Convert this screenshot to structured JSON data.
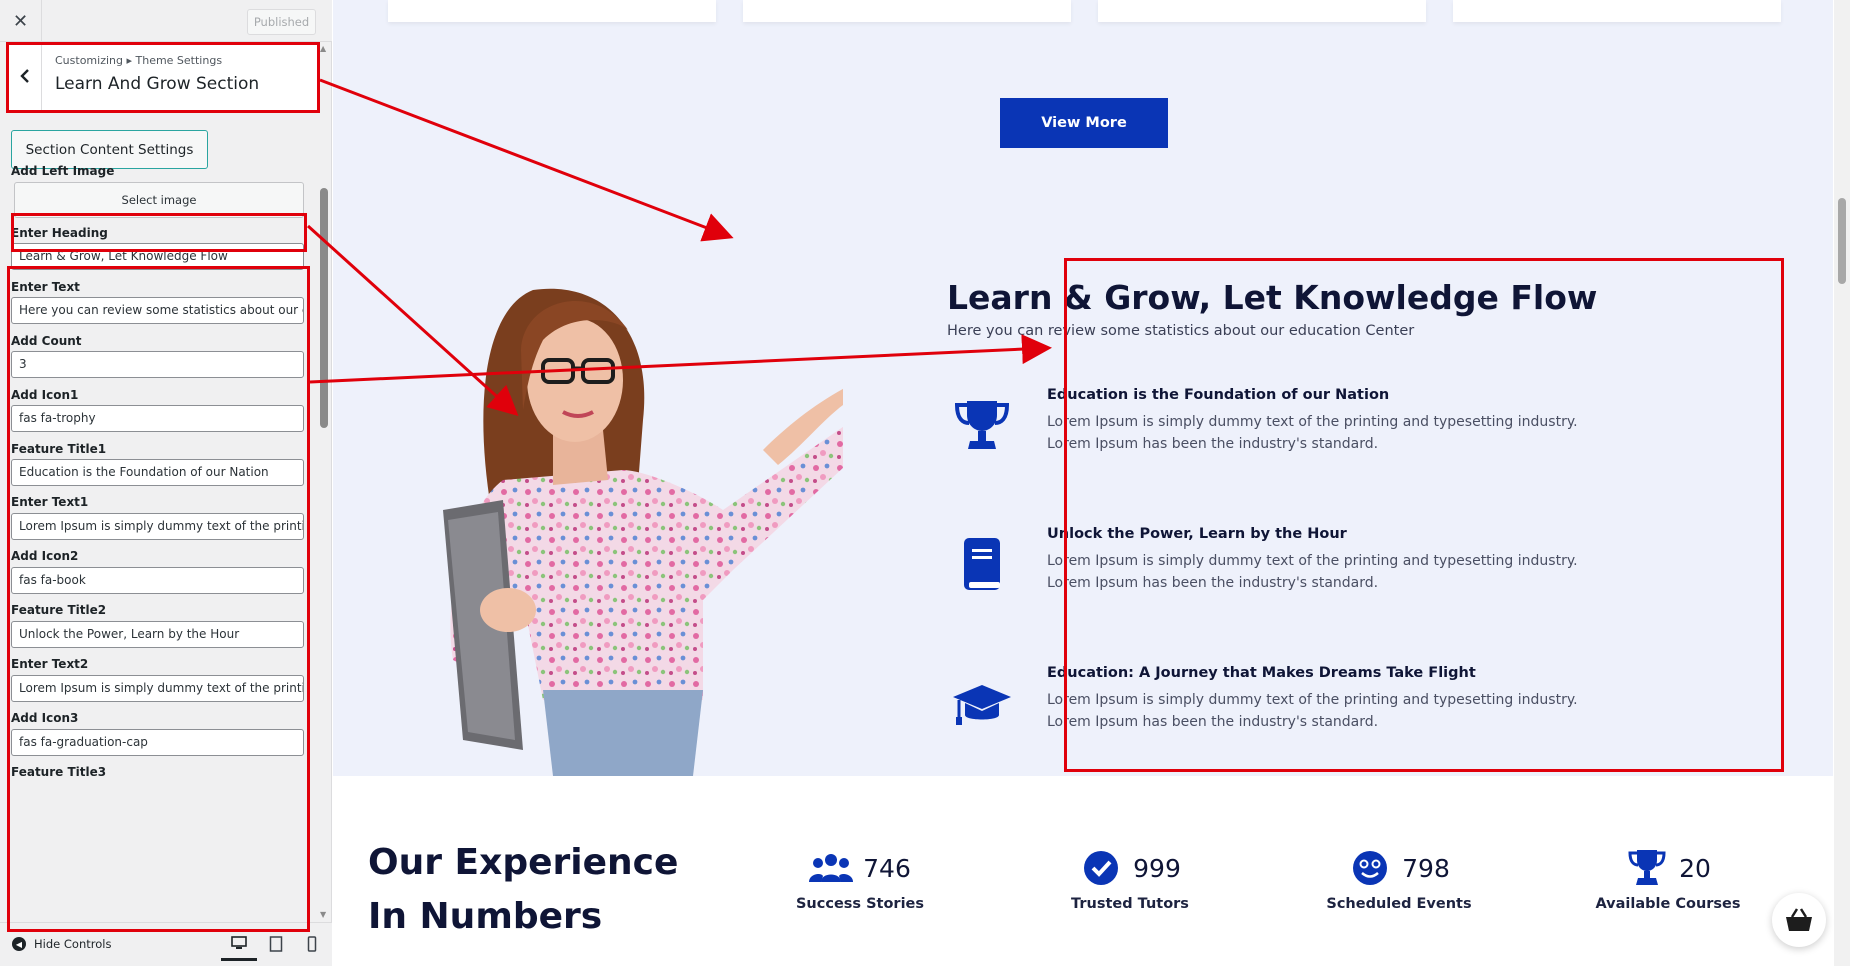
{
  "sidebar": {
    "close_label": "✕",
    "published_label": "Published",
    "breadcrumb": "Customizing ▸ Theme Settings",
    "section_title": "Learn And Grow Section",
    "content_settings_label": "Section Content Settings",
    "select_image_label": "Select image",
    "fields": [
      {
        "label": "Add Left Image"
      },
      {
        "label": "Enter Heading",
        "value": "Learn & Grow, Let Knowledge Flow"
      },
      {
        "label": "Enter Text",
        "value": "Here you can review some statistics about our education Center"
      },
      {
        "label": "Add Count",
        "value": "3"
      },
      {
        "label": "Add Icon1",
        "value": "fas fa-trophy"
      },
      {
        "label": "Feature Title1",
        "value": "Education is the Foundation of our Nation"
      },
      {
        "label": "Enter Text1",
        "value": "Lorem Ipsum is simply dummy text of the printing and typesetting industry."
      },
      {
        "label": "Add Icon2",
        "value": "fas fa-book"
      },
      {
        "label": "Feature Title2",
        "value": "Unlock the Power, Learn by the Hour"
      },
      {
        "label": "Enter Text2",
        "value": "Lorem Ipsum is simply dummy text of the printing and typesetting industry."
      },
      {
        "label": "Add Icon3",
        "value": "fas fa-graduation-cap"
      },
      {
        "label": "Feature Title3"
      }
    ],
    "hide_controls_label": "Hide Controls"
  },
  "preview": {
    "view_more_label": "View More",
    "heading": "Learn & Grow, Let Knowledge Flow",
    "subtext": "Here you can review some statistics about our education Center",
    "features": [
      {
        "icon": "trophy-icon",
        "title": "Education is the Foundation of our Nation",
        "text": "Lorem Ipsum is simply dummy text of the printing and typesetting industry. Lorem Ipsum has been the industry's standard."
      },
      {
        "icon": "book-icon",
        "title": "Unlock the Power, Learn by the Hour",
        "text": "Lorem Ipsum is simply dummy text of the printing and typesetting industry. Lorem Ipsum has been the industry's standard."
      },
      {
        "icon": "graduation-cap-icon",
        "title": "Education: A Journey that Makes Dreams Take Flight",
        "text": "Lorem Ipsum is simply dummy text of the printing and typesetting industry. Lorem Ipsum has been the industry's standard."
      }
    ],
    "stats_heading": "Our Experience In Numbers",
    "stats": [
      {
        "icon": "users-icon",
        "value": "746",
        "label": "Success Stories"
      },
      {
        "icon": "check-circle-icon",
        "value": "999",
        "label": "Trusted Tutors"
      },
      {
        "icon": "smile-icon",
        "value": "798",
        "label": "Scheduled Events"
      },
      {
        "icon": "trophy-icon",
        "value": "20",
        "label": "Available Courses"
      }
    ]
  },
  "colors": {
    "brand_blue": "#0a35b5",
    "annotation_red": "#e0000b",
    "preview_bg": "#eef1fb"
  }
}
